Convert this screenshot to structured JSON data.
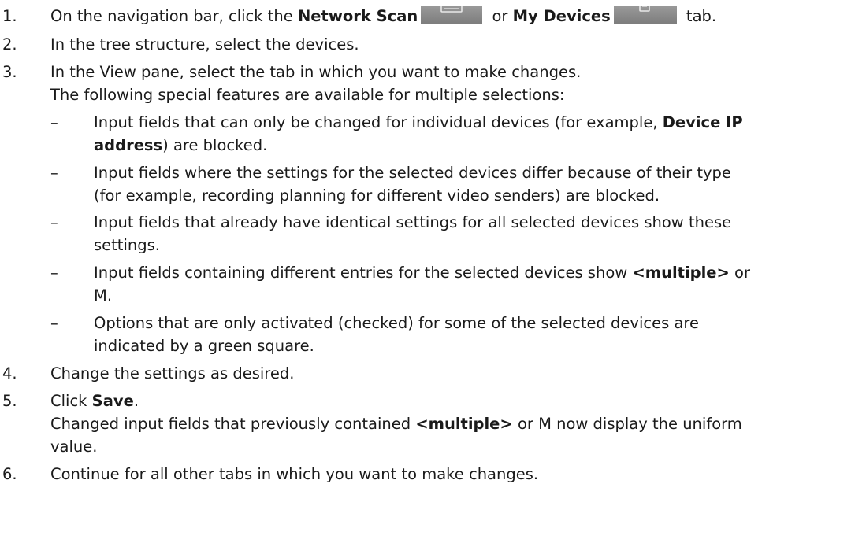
{
  "steps": [
    {
      "number": "1.",
      "parts": [
        "On the navigation bar, click the ",
        "Network Scan",
        " or ",
        "My Devices",
        " tab."
      ]
    },
    {
      "number": "2.",
      "text": "In the tree structure, select the devices."
    },
    {
      "number": "3.",
      "text": "In the View pane, select the tab in which you want to make changes."
    },
    {
      "text": "The following special features are available for multiple selections:"
    }
  ],
  "bullets": [
    {
      "dash": "–",
      "line1": [
        "Input fields that can only be changed for individual devices (for example, ",
        "Device IP"
      ],
      "line2": [
        "address",
        ") are blocked."
      ]
    },
    {
      "dash": "–",
      "line1": "Input fields where the settings for the selected devices differ because of their type",
      "line2": "(for example, recording planning for different video senders) are blocked."
    },
    {
      "dash": "–",
      "line1": "Input fields that already have identical settings for all selected devices show these",
      "line2": "settings."
    },
    {
      "dash": "–",
      "line1": [
        "Input fields containing different entries for the selected devices show ",
        "<multiple>",
        " or"
      ],
      "line2": "M."
    },
    {
      "dash": "–",
      "line1": "Options that are only activated (checked) for some of the selected devices are",
      "line2": "indicated by a green square."
    }
  ],
  "steps_after": [
    {
      "number": "4.",
      "text": "Change the settings as desired."
    },
    {
      "number": "5.",
      "parts": [
        "Click ",
        "Save",
        "."
      ]
    },
    {
      "line1": [
        "Changed input fields that previously contained ",
        "<multiple>",
        " or M now display the uniform"
      ],
      "line2": "value."
    },
    {
      "number": "6.",
      "text": "Continue for all other tabs in which you want to make changes."
    }
  ],
  "icons": {
    "network_scan": "network-scan-icon",
    "my_devices": "my-devices-icon",
    "icon_color": "#8c8c8c"
  }
}
